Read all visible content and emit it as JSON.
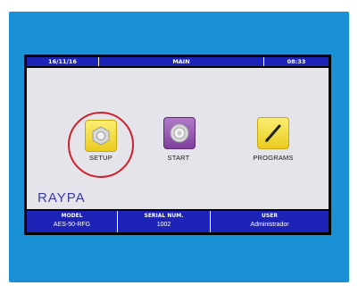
{
  "header": {
    "date": "16/11/16",
    "screen_title": "MAIN",
    "time": "08:33"
  },
  "menu": [
    {
      "label": "SETUP",
      "icon": "nut-icon",
      "color": "#f4e04a",
      "highlighted": true
    },
    {
      "label": "START",
      "icon": "valve-icon",
      "color": "#9b59b6"
    },
    {
      "label": "PROGRAMS",
      "icon": "pencil-icon",
      "color": "#f4e04a"
    }
  ],
  "brand": "RAYPA",
  "footer": {
    "model_label": "MODEL",
    "model_value": "AES-50-RFG",
    "serial_label": "SERIAL NUM.",
    "serial_value": "1002",
    "user_label": "USER",
    "user_value": "Administrador"
  },
  "colors": {
    "device_frame": "#1a91d7",
    "bar": "#1e23b8",
    "highlight_circle": "#d0202b",
    "background": "#e4e4ea"
  }
}
